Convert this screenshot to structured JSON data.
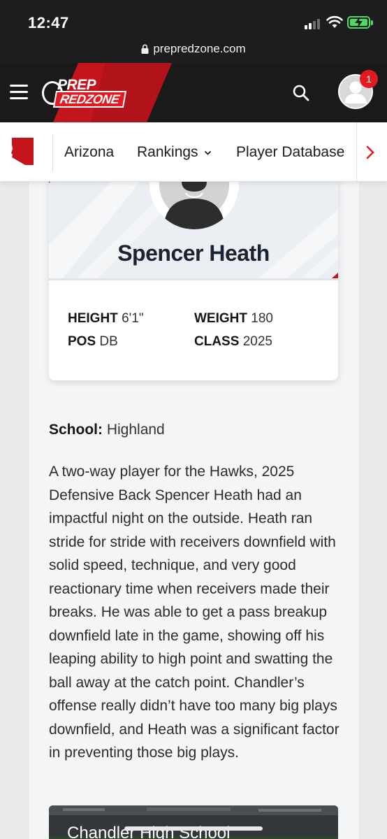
{
  "status_bar": {
    "time": "12:47"
  },
  "browser": {
    "url": "prepredzone.com"
  },
  "header": {
    "logo_top": "PREP",
    "logo_bottom": "REDZONE",
    "notification_count": "1",
    "accent_color": "#e21b22"
  },
  "nav": {
    "items": [
      {
        "label": "Arizona"
      },
      {
        "label": "Rankings"
      },
      {
        "label": "Player Database"
      }
    ]
  },
  "player": {
    "name": "Spencer Heath",
    "stats": {
      "height_label": "HEIGHT",
      "height_value": "6'1\"",
      "weight_label": "WEIGHT",
      "weight_value": "180",
      "pos_label": "POS",
      "pos_value": "DB",
      "class_label": "CLASS",
      "class_value": "2025"
    },
    "school_label": "School:",
    "school_value": "Highland"
  },
  "article": {
    "body": "A two-way player for the Hawks, 2025 Defensive Back Spencer Heath had an impactful night on the outside. Heath ran stride for stride with receivers downfield with solid speed, technique, and very good reactionary time when receivers made their breaks. He was able to get a pass breakup downfield late in the game, showing off his leaping ability to high point and swatting the ball away at the catch point. Chandler’s offense really didn’t have too many big plays downfield, and Heath was a significant factor in preventing those big plays."
  },
  "video": {
    "title": "Chandler High School"
  }
}
